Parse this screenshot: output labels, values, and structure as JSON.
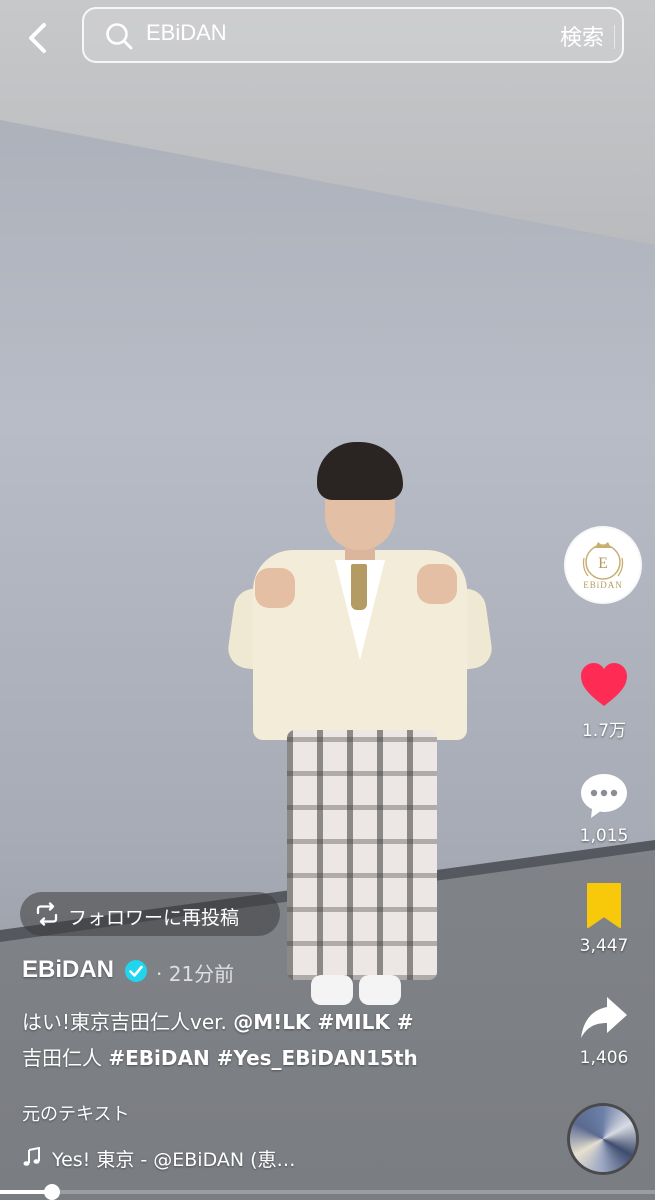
{
  "search": {
    "query": "EBiDAN",
    "submit_label": "検索"
  },
  "account": {
    "avatar_text": "EBiDAN"
  },
  "actions": {
    "likes": "1.7万",
    "comments": "1,015",
    "saves": "3,447",
    "shares": "1,406"
  },
  "repost": {
    "label": "フォロワーに再投稿"
  },
  "post": {
    "author": "EBiDAN",
    "time": "· 21分前",
    "caption_line1_plain": "はい!東京吉田仁人ver. ",
    "caption_line1_tags": "@M!LK #MILK #",
    "caption_line2_plain": "吉田仁人 ",
    "caption_line2_tags": "#EBiDAN #Yes_EBiDAN15th",
    "original_text_label": "元のテキスト"
  },
  "music": {
    "title": "Yes! 東京 - @EBiDAN (恵…"
  },
  "playback": {
    "progress": 0.08
  },
  "colors": {
    "like": "#fe2c55",
    "save": "#f8c80a",
    "verified": "#20d5ec"
  },
  "icons": [
    "chevron-left-icon",
    "search-icon",
    "heart-icon",
    "comment-icon",
    "bookmark-icon",
    "share-icon",
    "repost-icon",
    "verified-icon",
    "music-note-icon"
  ]
}
